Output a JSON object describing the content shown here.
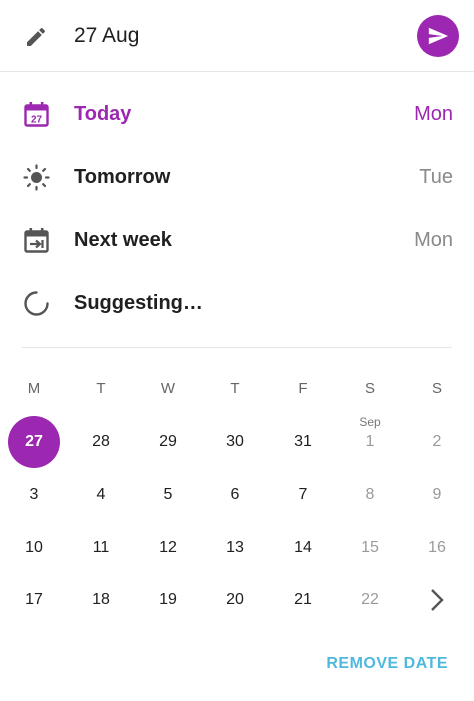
{
  "header": {
    "date_value": "27 Aug",
    "edit_icon": "pencil-icon",
    "send_icon": "send-icon",
    "accent": "#9C27B0"
  },
  "options": [
    {
      "label": "Today",
      "day": "Mon",
      "icon": "calendar-today-icon"
    },
    {
      "label": "Tomorrow",
      "day": "Tue",
      "icon": "sun-icon"
    },
    {
      "label": "Next week",
      "day": "Mon",
      "icon": "calendar-next-icon"
    },
    {
      "label": "Suggesting…",
      "day": "",
      "icon": "loading-spinner-icon"
    }
  ],
  "calendar": {
    "weekdays": [
      "M",
      "T",
      "W",
      "T",
      "F",
      "S",
      "S"
    ],
    "month_tag": "Sep",
    "selected": "27",
    "weeks": [
      [
        "27",
        "28",
        "29",
        "30",
        "31",
        "1",
        "2"
      ],
      [
        "3",
        "4",
        "5",
        "6",
        "7",
        "8",
        "9"
      ],
      [
        "10",
        "11",
        "12",
        "13",
        "14",
        "15",
        "16"
      ],
      [
        "17",
        "18",
        "19",
        "20",
        "21",
        "22",
        ""
      ]
    ],
    "next_icon": "chevron-right-icon"
  },
  "footer": {
    "remove_label": "REMOVE DATE",
    "remove_color": "#4FB8DE"
  }
}
